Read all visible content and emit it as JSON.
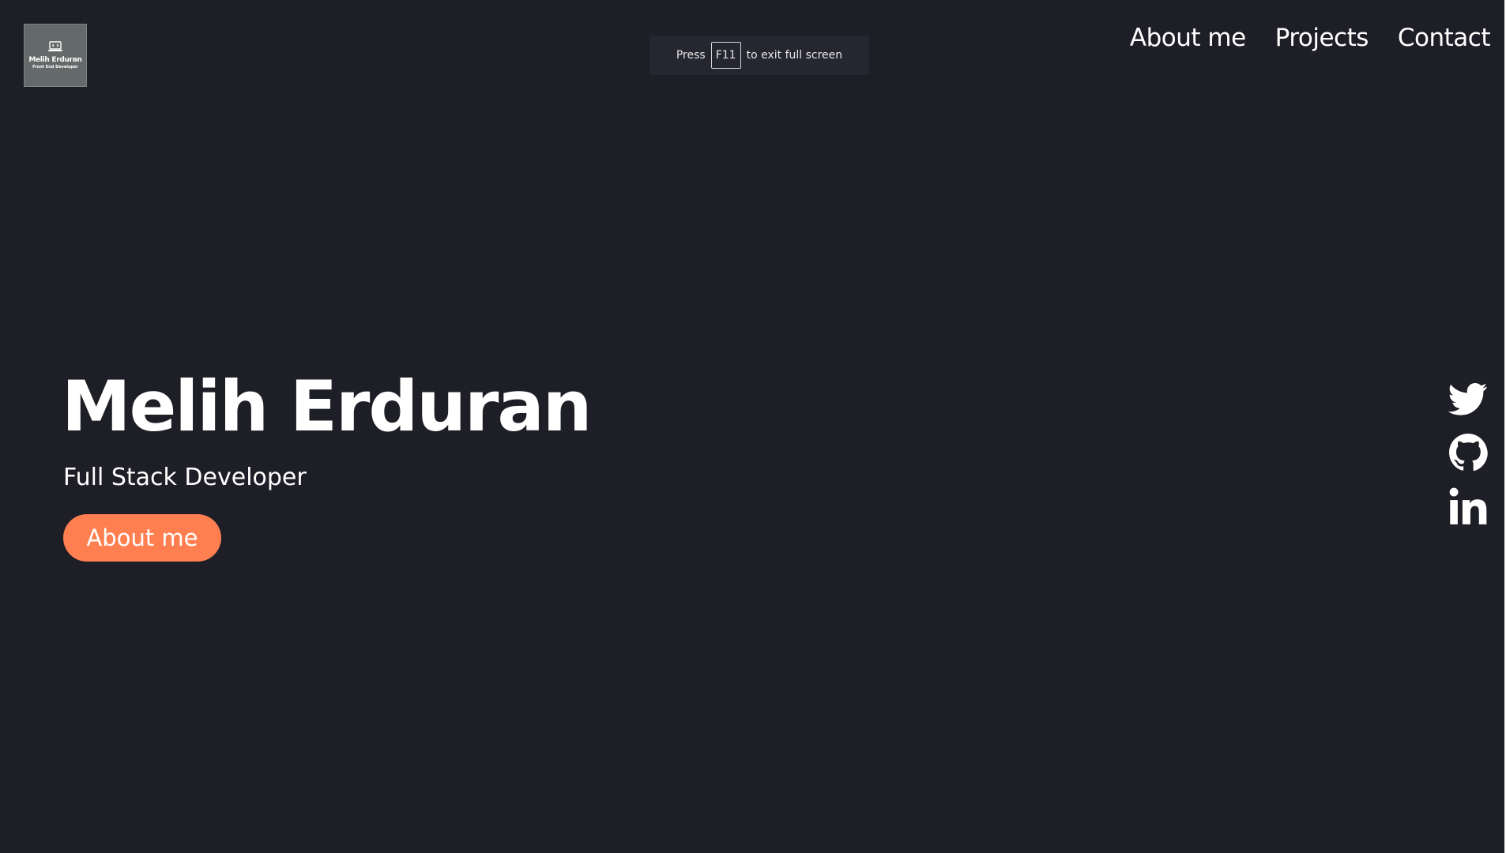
{
  "logo": {
    "name": "Melih Erduran",
    "subtitle": "Front End Developer"
  },
  "fullscreen_notice": {
    "prefix": "Press",
    "key": "F11",
    "suffix": "to exit full screen"
  },
  "nav": {
    "items": [
      {
        "label": "About me"
      },
      {
        "label": "Projects"
      },
      {
        "label": "Contact"
      }
    ]
  },
  "hero": {
    "name": "Melih Erduran",
    "role": "Full Stack Developer",
    "button_label": "About me"
  },
  "social": {
    "icons": [
      "twitter-icon",
      "github-icon",
      "linkedin-icon"
    ]
  },
  "colors": {
    "background": "#1e1e27",
    "accent": "#ff7f50",
    "text": "#ffffff",
    "logo_bg": "#646a6a"
  }
}
